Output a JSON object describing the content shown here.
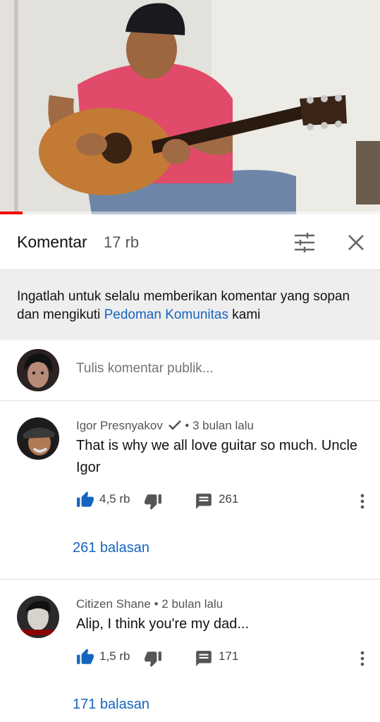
{
  "video": {
    "progress_fraction": 0.06
  },
  "header": {
    "title": "Komentar",
    "count": "17 rb"
  },
  "notice": {
    "text_before": "Ingatlah untuk selalu memberikan komentar yang sopan dan mengikuti ",
    "link": "Pedoman Komunitas",
    "text_after": " kami"
  },
  "compose": {
    "placeholder": "Tulis komentar publik..."
  },
  "comments": [
    {
      "author": "Igor Presnyakov",
      "verified": true,
      "separator": "•",
      "time": "3 bulan lalu",
      "text": "That is why we all love guitar so much. Uncle Igor",
      "likes": "4,5 rb",
      "reply_count": "261",
      "replies_label": "261 balasan"
    },
    {
      "author": "Citizen Shane",
      "verified": false,
      "separator": "•",
      "time": "2 bulan lalu",
      "text": "Alip, I think you're my dad...",
      "likes": "1,5 rb",
      "reply_count": "171",
      "replies_label": "171 balasan"
    }
  ],
  "colors": {
    "accent_blue": "#1565c0",
    "progress_red": "#ee0000",
    "notice_bg": "#eeeeee"
  }
}
